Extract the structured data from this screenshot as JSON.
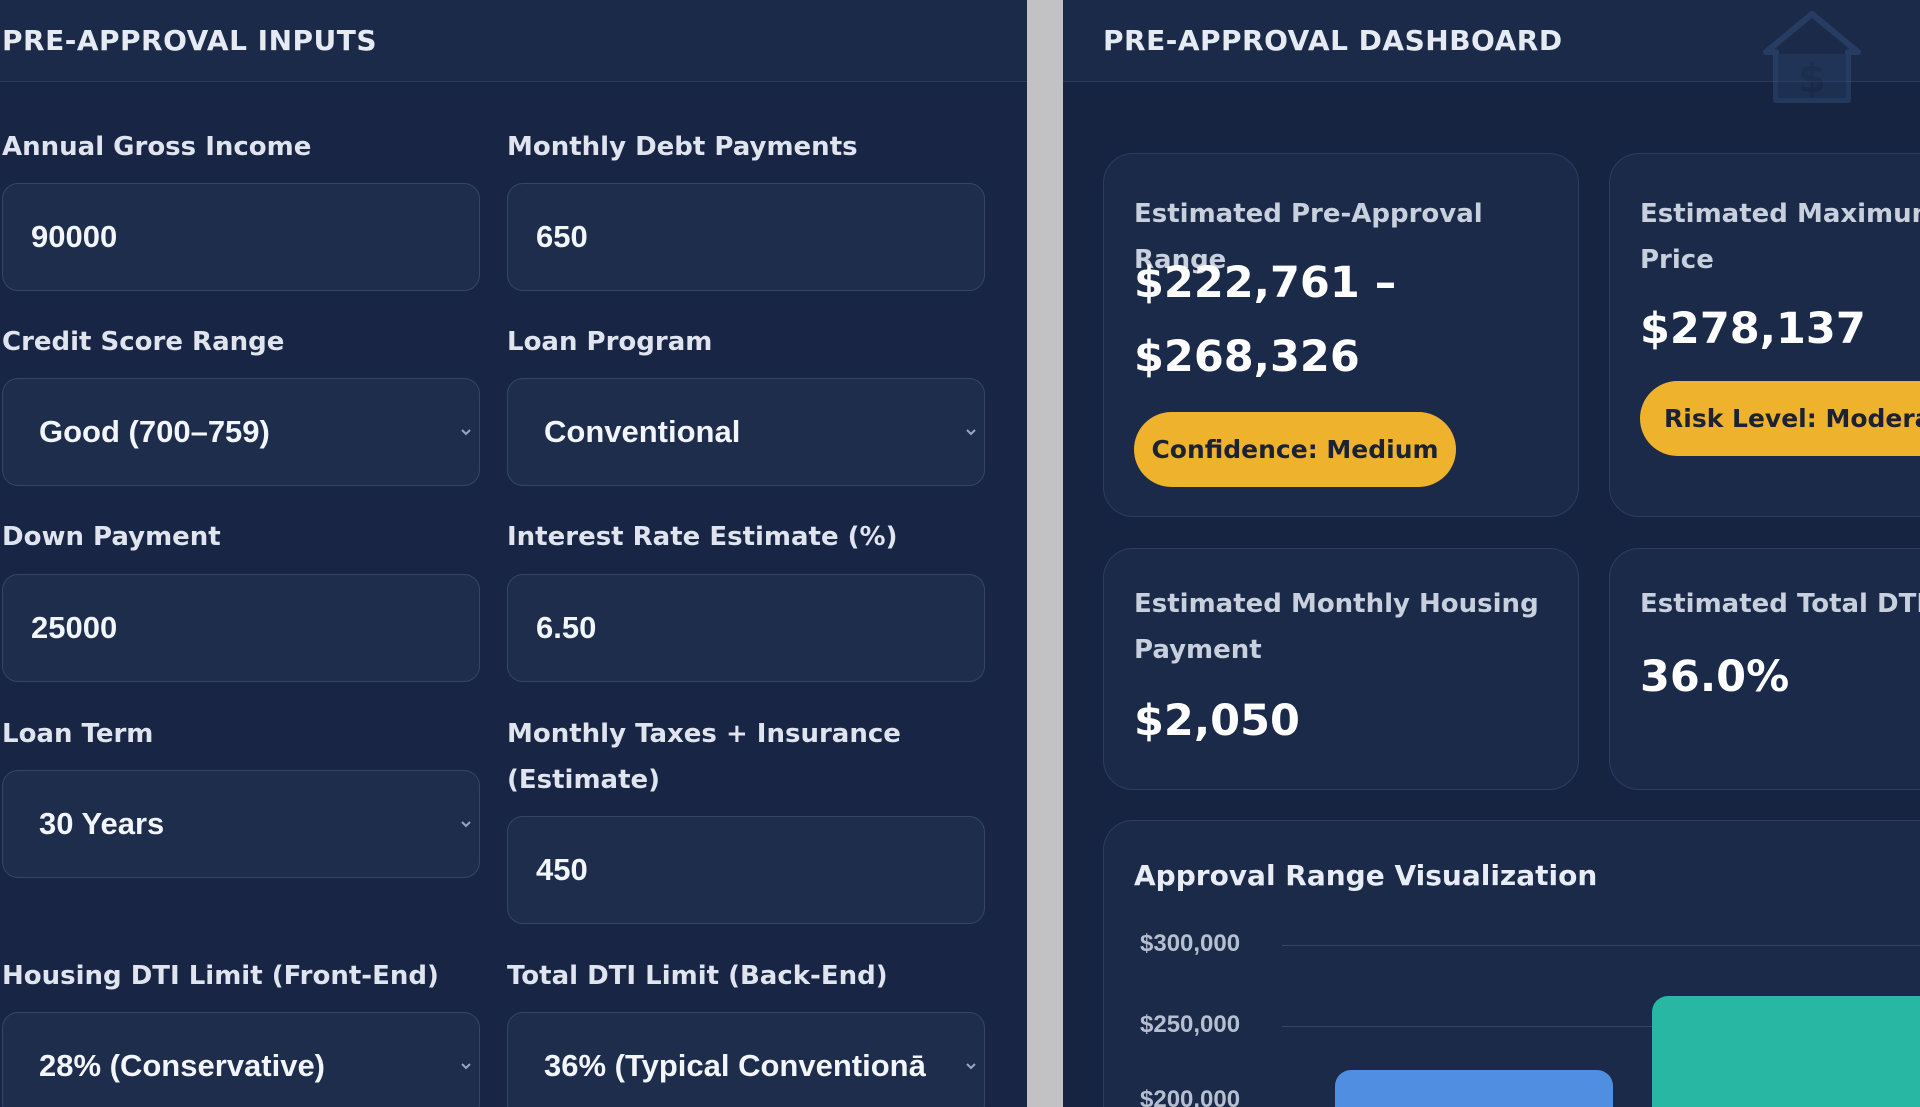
{
  "inputs_panel": {
    "title": "PRE-APPROVAL INPUTS",
    "annual_gross_income": {
      "label": "Annual Gross Income",
      "value": "90000"
    },
    "monthly_debt_payments": {
      "label": "Monthly Debt Payments",
      "value": "650"
    },
    "credit_score_range": {
      "label": "Credit Score Range",
      "value": "Good (700–759)"
    },
    "loan_program": {
      "label": "Loan Program",
      "value": "Conventional"
    },
    "down_payment": {
      "label": "Down Payment",
      "value": "25000"
    },
    "interest_rate": {
      "label": "Interest Rate Estimate (%)",
      "value": "6.50"
    },
    "loan_term": {
      "label": "Loan Term",
      "value": "30 Years"
    },
    "taxes_insurance": {
      "label_line1": "Monthly Taxes + Insurance",
      "label_line2": "(Estimate)",
      "value": "450"
    },
    "housing_dti": {
      "label": "Housing DTI Limit (Front-End)",
      "value": "28% (Conservative)"
    },
    "total_dti": {
      "label": "Total DTI Limit (Back-End)",
      "value": "36% (Typical Conventionā"
    }
  },
  "dashboard": {
    "title": "PRE-APPROVAL DASHBOARD",
    "icon": "house-dollar-icon",
    "range_card": {
      "label": "Estimated Pre-Approval Range",
      "value_line1": "$222,761 –",
      "value_line2": "$268,326",
      "badge": "Confidence: Medium"
    },
    "max_price_card": {
      "label_line1": "Estimated Maximum",
      "label_line2": "Price",
      "value": "$278,137",
      "badge": "Risk Level: Modera"
    },
    "housing_payment_card": {
      "label_line1": "Estimated Monthly Housing",
      "label_line2": "Payment",
      "value": "$2,050"
    },
    "total_dti_card": {
      "label": "Estimated Total DTI I",
      "value": "36.0%"
    }
  },
  "colors": {
    "accent_yellow": "#efb22c",
    "bar_blue": "#4f8ee0",
    "bar_teal": "#27b7a3"
  },
  "chart_data": {
    "type": "bar",
    "title": "Approval Range Visualization",
    "y_ticks": [
      "$300,000",
      "$250,000",
      "$200,000"
    ],
    "ylim": [
      200000,
      300000
    ],
    "series": [
      {
        "values": [
          222761
        ]
      },
      {
        "values": [
          268326
        ]
      }
    ]
  }
}
